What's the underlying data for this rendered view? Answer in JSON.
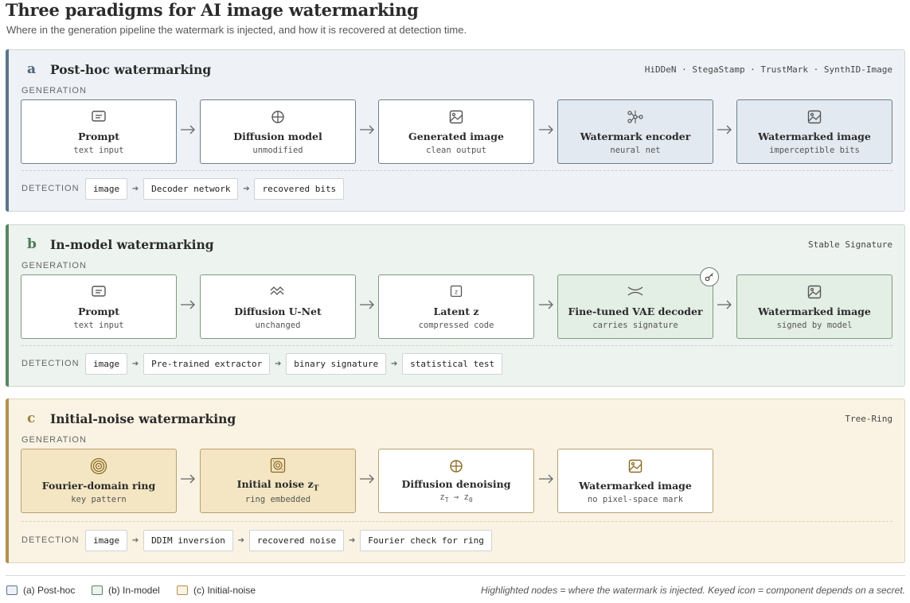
{
  "title": "Three paradigms for AI image watermarking",
  "subtitle": "Where in the generation pipeline the watermark is injected, and how it is recovered at detection time.",
  "labels": {
    "generation": "GENERATION",
    "detection": "DETECTION"
  },
  "panels": [
    {
      "letter": "a",
      "title": "Post-hoc watermarking",
      "tags": "HiDDeN · StegaStamp · TrustMark · SynthID-Image",
      "nodes": [
        {
          "title": "Prompt",
          "sub": "text input",
          "icon": "prompt-icon",
          "highlight": false
        },
        {
          "title": "Diffusion model",
          "sub": "unmodified",
          "icon": "crosshair-icon",
          "highlight": false
        },
        {
          "title": "Generated image",
          "sub": "clean output",
          "icon": "image-icon",
          "highlight": false
        },
        {
          "title": "Watermark encoder",
          "sub": "neural net",
          "icon": "network-icon",
          "highlight": true
        },
        {
          "title": "Watermarked image",
          "sub": "imperceptible bits",
          "icon": "image-icon",
          "highlight": true
        }
      ],
      "detection": [
        "image",
        "Decoder network",
        "recovered bits"
      ]
    },
    {
      "letter": "b",
      "title": "In-model watermarking",
      "tags": "Stable Signature",
      "nodes": [
        {
          "title": "Prompt",
          "sub": "text input",
          "icon": "prompt-icon",
          "highlight": false
        },
        {
          "title": "Diffusion U-Net",
          "sub": "unchanged",
          "icon": "wave-icon",
          "highlight": false
        },
        {
          "title": "Latent z",
          "sub": "compressed code",
          "icon": "latent-icon",
          "highlight": false
        },
        {
          "title": "Fine-tuned VAE decoder",
          "sub": "carries signature",
          "icon": "decoder-icon",
          "highlight": true,
          "keyed": true
        },
        {
          "title": "Watermarked image",
          "sub": "signed by model",
          "icon": "image-icon",
          "highlight": true
        }
      ],
      "detection": [
        "image",
        "Pre-trained extractor",
        "binary signature",
        "statistical test"
      ]
    },
    {
      "letter": "c",
      "title": "Initial-noise watermarking",
      "tags": "Tree-Ring",
      "nodes": [
        {
          "title": "Fourier-domain ring",
          "sub": "key pattern",
          "icon": "ring-icon",
          "highlight": true
        },
        {
          "title": "Initial noise z",
          "title_sub": "T",
          "sub": "ring embedded",
          "icon": "noise-icon",
          "highlight": true
        },
        {
          "title": "Diffusion denoising",
          "sub": "z",
          "sub_a": "T",
          "sub_arrow": " → z",
          "sub_b": "0",
          "icon": "crosshair-icon",
          "highlight": false
        },
        {
          "title": "Watermarked image",
          "sub": "no pixel-space mark",
          "icon": "image-icon",
          "highlight": false
        }
      ],
      "detection": [
        "image",
        "DDIM inversion",
        "recovered noise",
        "Fourier check for ring"
      ]
    }
  ],
  "legend": {
    "items": [
      "(a) Post-hoc",
      "(b) In-model",
      "(c) Initial-noise"
    ],
    "note": "Highlighted nodes = where the watermark is injected. Keyed icon = component depends on a secret."
  },
  "colors": {
    "a_accent": "#5c7486",
    "b_accent": "#5b8463",
    "c_accent": "#b1924f",
    "a_bg": "#eef2f6",
    "b_bg": "#edf3ee",
    "c_bg": "#faf3e3"
  }
}
